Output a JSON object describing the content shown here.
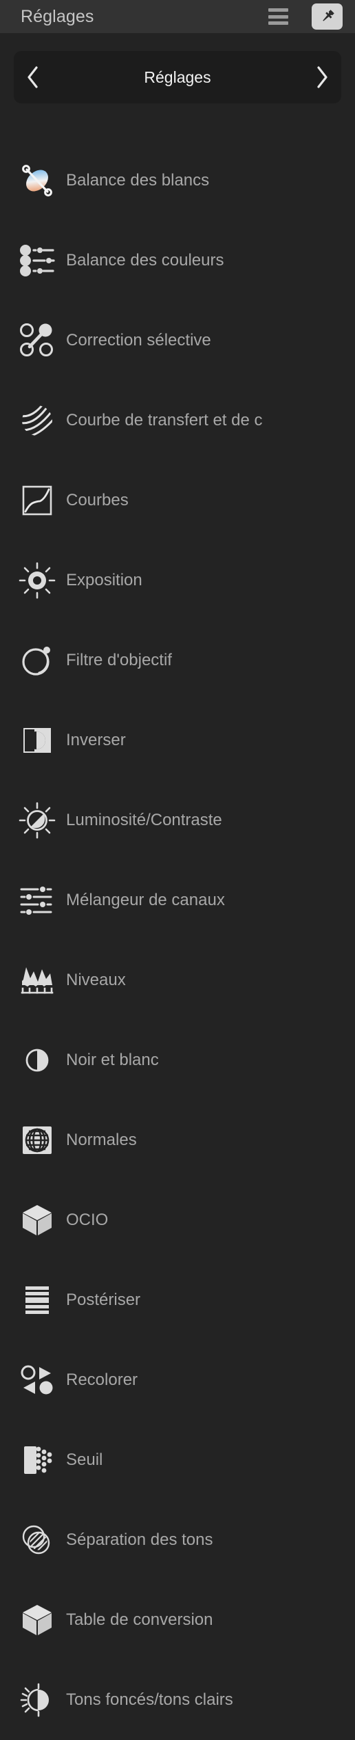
{
  "header": {
    "title": "Réglages",
    "menu_icon": "hamburger-icon",
    "pin_icon": "pushpin-icon"
  },
  "navigation": {
    "back_icon": "chevron-left-icon",
    "forward_icon": "chevron-right-icon",
    "title": "Réglages"
  },
  "list": {
    "items": [
      {
        "label": "Balance des blancs",
        "icon": "white-balance-icon"
      },
      {
        "label": "Balance des couleurs",
        "icon": "color-balance-icon"
      },
      {
        "label": "Correction sélective",
        "icon": "selective-color-icon"
      },
      {
        "label": "Courbe de transfert et de c",
        "icon": "transfer-curve-icon"
      },
      {
        "label": "Courbes",
        "icon": "curves-icon"
      },
      {
        "label": "Exposition",
        "icon": "exposure-icon"
      },
      {
        "label": "Filtre d'objectif",
        "icon": "lens-filter-icon"
      },
      {
        "label": "Inverser",
        "icon": "invert-icon"
      },
      {
        "label": "Luminosité/Contraste",
        "icon": "brightness-contrast-icon"
      },
      {
        "label": "Mélangeur de canaux",
        "icon": "channel-mixer-icon"
      },
      {
        "label": "Niveaux",
        "icon": "levels-icon"
      },
      {
        "label": "Noir et blanc",
        "icon": "black-and-white-icon"
      },
      {
        "label": "Normales",
        "icon": "normals-icon"
      },
      {
        "label": "OCIO",
        "icon": "ocio-cube-icon"
      },
      {
        "label": "Postériser",
        "icon": "posterize-icon"
      },
      {
        "label": "Recolorer",
        "icon": "recolor-icon"
      },
      {
        "label": "Seuil",
        "icon": "threshold-icon"
      },
      {
        "label": "Séparation des tons",
        "icon": "split-toning-icon"
      },
      {
        "label": "Table de conversion",
        "icon": "lookup-table-icon"
      },
      {
        "label": "Tons foncés/tons clairs",
        "icon": "shadows-highlights-icon"
      }
    ]
  },
  "colors": {
    "header_bg": "#333333",
    "panel_bg": "#232323",
    "navstrip_bg": "#1c1c1c",
    "label_text": "#a8a8a8",
    "title_text": "#c6c6c6",
    "icon_fill": "#d8d8d8",
    "accent_cool": "#5aa9e6",
    "accent_warm": "#e8834a"
  }
}
